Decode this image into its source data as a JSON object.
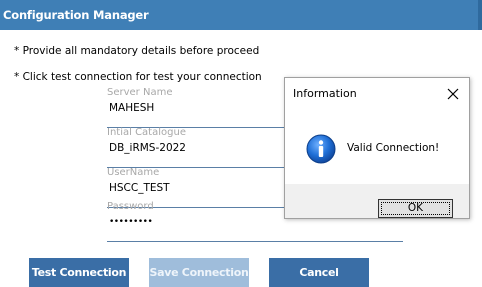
{
  "window": {
    "title": "Configuration Manager"
  },
  "notes": [
    "* Provide all mandatory details before proceed",
    "* Click test connection for test your connection"
  ],
  "fields": [
    {
      "label": "Server Name",
      "value": "MAHESH"
    },
    {
      "label": "Intial Catalogue",
      "value": "DB_iRMS-2022"
    },
    {
      "label": "UserName",
      "value": "HSCC_TEST"
    },
    {
      "label": "Password",
      "value": "•••••••••"
    }
  ],
  "buttons": {
    "test": "Test Connection",
    "save": "Save Connection",
    "cancel": "Cancel"
  },
  "dialog": {
    "title": "Information",
    "message": "Valid Connection!",
    "ok": "OK",
    "icon": "info-icon"
  },
  "colors": {
    "titlebar": "#3f7fb6",
    "button": "#3a6ea6",
    "button_disabled": "#9fbddb"
  }
}
